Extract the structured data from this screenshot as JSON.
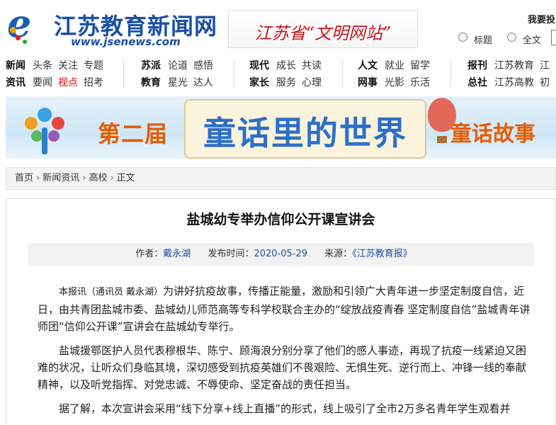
{
  "logo": {
    "mark": "e",
    "name": "江苏教育新闻网",
    "url": "www.jsenews.com"
  },
  "civ_badge": "江苏省“文明网站”",
  "search": {
    "title": "我要投",
    "options": [
      "标题",
      "全文"
    ]
  },
  "nav": [
    {
      "rows": [
        {
          "head": "新闻",
          "items": [
            "头条",
            "关注",
            "专题"
          ]
        },
        {
          "head": "资讯",
          "items": [
            "要闻",
            "视点",
            "招考"
          ]
        }
      ]
    },
    {
      "rows": [
        {
          "head": "苏派",
          "items": [
            "论道",
            "感悟"
          ]
        },
        {
          "head": "教育",
          "items": [
            "星光",
            "达人"
          ]
        }
      ]
    },
    {
      "rows": [
        {
          "head": "现代",
          "items": [
            "成长",
            "共读"
          ]
        },
        {
          "head": "家长",
          "items": [
            "服务",
            "心理"
          ]
        }
      ]
    },
    {
      "rows": [
        {
          "head": "人文",
          "items": [
            "就业",
            "留学"
          ]
        },
        {
          "head": "网事",
          "items": [
            "光影",
            "乐活"
          ]
        }
      ]
    },
    {
      "rows": [
        {
          "head": "报刊",
          "items": [
            "江苏教育",
            "江"
          ]
        },
        {
          "head": "总社",
          "items": [
            "江苏高教",
            "初"
          ]
        }
      ]
    }
  ],
  "nav_active": "视点",
  "banner": {
    "left": "第二届",
    "center": "童话里的世界",
    "right": "童话故事"
  },
  "breadcrumb": [
    "首页",
    "新闻资讯",
    "高校",
    "正文"
  ],
  "article": {
    "title": "盐城幼专举办信仰公开课宣讲会",
    "meta": {
      "author_label": "作者：",
      "author": "戴永湖",
      "date_label": "发布时间：",
      "date": "2020-05-29",
      "source_label": "来源：",
      "source": "《江苏教育报》"
    },
    "lead": "本报讯（通讯员  戴永湖）",
    "paragraphs": [
      "为讲好抗疫故事，传播正能量，激励和引领广大青年进一步坚定制度自信，近日，由共青团盐城市委、盐城幼儿师范高等专科学校联合主办的“绽放战疫青春 坚定制度自信”盐城青年讲师团“信仰公开课”宣讲会在盐城幼专举行。",
      "盐城援鄂医护人员代表穆根华、陈宁、顾海浪分别分享了他们的感人事迹，再现了抗疫一线紧迫又困难的状况，让听众们身临其境，深切感受到抗疫英雄们不畏艰险、无惧生死、逆行而上、冲锋一线的奉献精神，以及听党指挥、对党忠诚、不辱使命、坚定奋战的责任担当。",
      "据了解，本次宣讲会采用“线下分享+线上直播”的形式，线上吸引了全市2万多名青年学生观看并"
    ]
  },
  "colors": {
    "brand_blue": "#1a4fa3",
    "nav_active": "#dd0000",
    "civ_red": "#c8161d",
    "banner_orange": "#e65c00"
  }
}
